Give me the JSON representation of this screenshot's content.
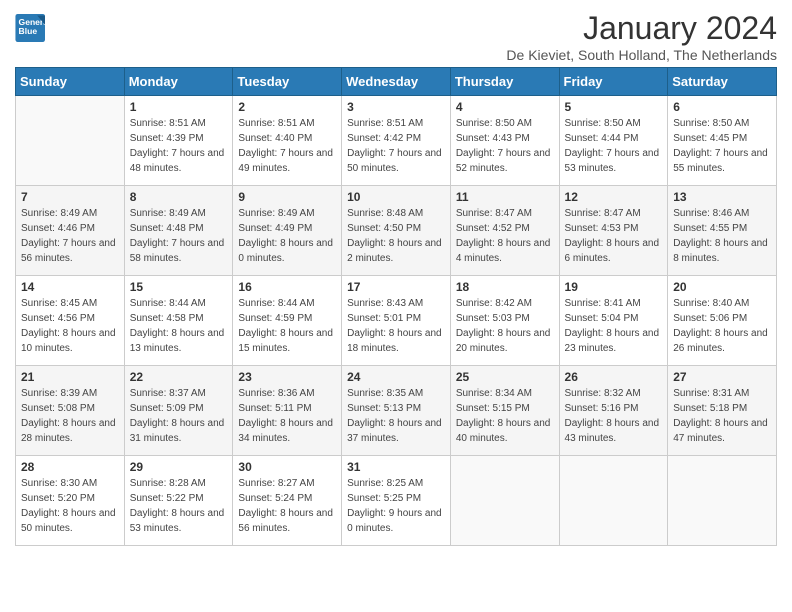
{
  "header": {
    "logo_line1": "General",
    "logo_line2": "Blue",
    "month": "January 2024",
    "location": "De Kieviet, South Holland, The Netherlands"
  },
  "weekdays": [
    "Sunday",
    "Monday",
    "Tuesday",
    "Wednesday",
    "Thursday",
    "Friday",
    "Saturday"
  ],
  "weeks": [
    [
      {
        "day": "",
        "sunrise": "",
        "sunset": "",
        "daylight": ""
      },
      {
        "day": "1",
        "sunrise": "Sunrise: 8:51 AM",
        "sunset": "Sunset: 4:39 PM",
        "daylight": "Daylight: 7 hours and 48 minutes."
      },
      {
        "day": "2",
        "sunrise": "Sunrise: 8:51 AM",
        "sunset": "Sunset: 4:40 PM",
        "daylight": "Daylight: 7 hours and 49 minutes."
      },
      {
        "day": "3",
        "sunrise": "Sunrise: 8:51 AM",
        "sunset": "Sunset: 4:42 PM",
        "daylight": "Daylight: 7 hours and 50 minutes."
      },
      {
        "day": "4",
        "sunrise": "Sunrise: 8:50 AM",
        "sunset": "Sunset: 4:43 PM",
        "daylight": "Daylight: 7 hours and 52 minutes."
      },
      {
        "day": "5",
        "sunrise": "Sunrise: 8:50 AM",
        "sunset": "Sunset: 4:44 PM",
        "daylight": "Daylight: 7 hours and 53 minutes."
      },
      {
        "day": "6",
        "sunrise": "Sunrise: 8:50 AM",
        "sunset": "Sunset: 4:45 PM",
        "daylight": "Daylight: 7 hours and 55 minutes."
      }
    ],
    [
      {
        "day": "7",
        "sunrise": "Sunrise: 8:49 AM",
        "sunset": "Sunset: 4:46 PM",
        "daylight": "Daylight: 7 hours and 56 minutes."
      },
      {
        "day": "8",
        "sunrise": "Sunrise: 8:49 AM",
        "sunset": "Sunset: 4:48 PM",
        "daylight": "Daylight: 7 hours and 58 minutes."
      },
      {
        "day": "9",
        "sunrise": "Sunrise: 8:49 AM",
        "sunset": "Sunset: 4:49 PM",
        "daylight": "Daylight: 8 hours and 0 minutes."
      },
      {
        "day": "10",
        "sunrise": "Sunrise: 8:48 AM",
        "sunset": "Sunset: 4:50 PM",
        "daylight": "Daylight: 8 hours and 2 minutes."
      },
      {
        "day": "11",
        "sunrise": "Sunrise: 8:47 AM",
        "sunset": "Sunset: 4:52 PM",
        "daylight": "Daylight: 8 hours and 4 minutes."
      },
      {
        "day": "12",
        "sunrise": "Sunrise: 8:47 AM",
        "sunset": "Sunset: 4:53 PM",
        "daylight": "Daylight: 8 hours and 6 minutes."
      },
      {
        "day": "13",
        "sunrise": "Sunrise: 8:46 AM",
        "sunset": "Sunset: 4:55 PM",
        "daylight": "Daylight: 8 hours and 8 minutes."
      }
    ],
    [
      {
        "day": "14",
        "sunrise": "Sunrise: 8:45 AM",
        "sunset": "Sunset: 4:56 PM",
        "daylight": "Daylight: 8 hours and 10 minutes."
      },
      {
        "day": "15",
        "sunrise": "Sunrise: 8:44 AM",
        "sunset": "Sunset: 4:58 PM",
        "daylight": "Daylight: 8 hours and 13 minutes."
      },
      {
        "day": "16",
        "sunrise": "Sunrise: 8:44 AM",
        "sunset": "Sunset: 4:59 PM",
        "daylight": "Daylight: 8 hours and 15 minutes."
      },
      {
        "day": "17",
        "sunrise": "Sunrise: 8:43 AM",
        "sunset": "Sunset: 5:01 PM",
        "daylight": "Daylight: 8 hours and 18 minutes."
      },
      {
        "day": "18",
        "sunrise": "Sunrise: 8:42 AM",
        "sunset": "Sunset: 5:03 PM",
        "daylight": "Daylight: 8 hours and 20 minutes."
      },
      {
        "day": "19",
        "sunrise": "Sunrise: 8:41 AM",
        "sunset": "Sunset: 5:04 PM",
        "daylight": "Daylight: 8 hours and 23 minutes."
      },
      {
        "day": "20",
        "sunrise": "Sunrise: 8:40 AM",
        "sunset": "Sunset: 5:06 PM",
        "daylight": "Daylight: 8 hours and 26 minutes."
      }
    ],
    [
      {
        "day": "21",
        "sunrise": "Sunrise: 8:39 AM",
        "sunset": "Sunset: 5:08 PM",
        "daylight": "Daylight: 8 hours and 28 minutes."
      },
      {
        "day": "22",
        "sunrise": "Sunrise: 8:37 AM",
        "sunset": "Sunset: 5:09 PM",
        "daylight": "Daylight: 8 hours and 31 minutes."
      },
      {
        "day": "23",
        "sunrise": "Sunrise: 8:36 AM",
        "sunset": "Sunset: 5:11 PM",
        "daylight": "Daylight: 8 hours and 34 minutes."
      },
      {
        "day": "24",
        "sunrise": "Sunrise: 8:35 AM",
        "sunset": "Sunset: 5:13 PM",
        "daylight": "Daylight: 8 hours and 37 minutes."
      },
      {
        "day": "25",
        "sunrise": "Sunrise: 8:34 AM",
        "sunset": "Sunset: 5:15 PM",
        "daylight": "Daylight: 8 hours and 40 minutes."
      },
      {
        "day": "26",
        "sunrise": "Sunrise: 8:32 AM",
        "sunset": "Sunset: 5:16 PM",
        "daylight": "Daylight: 8 hours and 43 minutes."
      },
      {
        "day": "27",
        "sunrise": "Sunrise: 8:31 AM",
        "sunset": "Sunset: 5:18 PM",
        "daylight": "Daylight: 8 hours and 47 minutes."
      }
    ],
    [
      {
        "day": "28",
        "sunrise": "Sunrise: 8:30 AM",
        "sunset": "Sunset: 5:20 PM",
        "daylight": "Daylight: 8 hours and 50 minutes."
      },
      {
        "day": "29",
        "sunrise": "Sunrise: 8:28 AM",
        "sunset": "Sunset: 5:22 PM",
        "daylight": "Daylight: 8 hours and 53 minutes."
      },
      {
        "day": "30",
        "sunrise": "Sunrise: 8:27 AM",
        "sunset": "Sunset: 5:24 PM",
        "daylight": "Daylight: 8 hours and 56 minutes."
      },
      {
        "day": "31",
        "sunrise": "Sunrise: 8:25 AM",
        "sunset": "Sunset: 5:25 PM",
        "daylight": "Daylight: 9 hours and 0 minutes."
      },
      {
        "day": "",
        "sunrise": "",
        "sunset": "",
        "daylight": ""
      },
      {
        "day": "",
        "sunrise": "",
        "sunset": "",
        "daylight": ""
      },
      {
        "day": "",
        "sunrise": "",
        "sunset": "",
        "daylight": ""
      }
    ]
  ]
}
